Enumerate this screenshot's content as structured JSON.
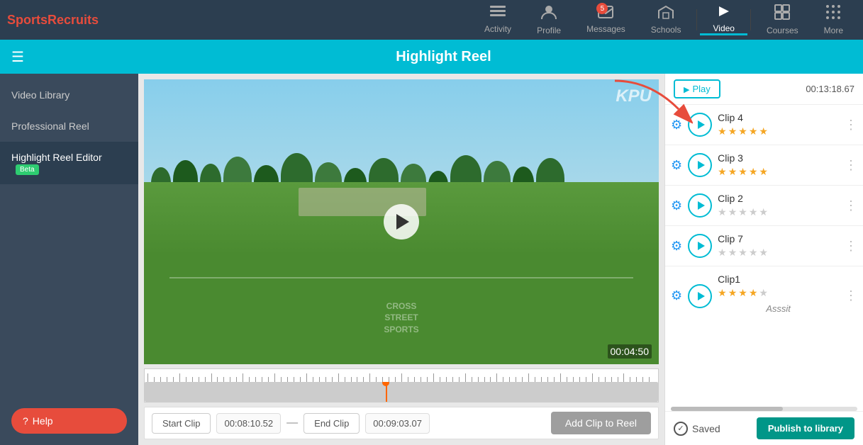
{
  "app": {
    "logo_sports": "Sports",
    "logo_recruits": "Recruits"
  },
  "nav": {
    "items": [
      {
        "id": "activity",
        "label": "Activity",
        "icon": "☰",
        "active": false,
        "badge": null
      },
      {
        "id": "profile",
        "label": "Profile",
        "icon": "👤",
        "active": false,
        "badge": null
      },
      {
        "id": "messages",
        "label": "Messages",
        "icon": "✉",
        "active": false,
        "badge": "5"
      },
      {
        "id": "schools",
        "label": "Schools",
        "icon": "🏛",
        "active": false,
        "badge": null
      },
      {
        "id": "video",
        "label": "Video",
        "icon": "▶",
        "active": true,
        "badge": null
      },
      {
        "id": "courses",
        "label": "Courses",
        "icon": "⊞",
        "active": false,
        "badge": null
      },
      {
        "id": "more",
        "label": "More",
        "icon": "⋮⋮⋮",
        "active": false,
        "badge": null
      }
    ]
  },
  "header": {
    "title": "Highlight Reel"
  },
  "sidebar": {
    "items": [
      {
        "id": "video-library",
        "label": "Video Library",
        "active": false,
        "beta": false
      },
      {
        "id": "professional-reel",
        "label": "Professional Reel",
        "active": false,
        "beta": false
      },
      {
        "id": "highlight-reel-editor",
        "label": "Highlight Reel Editor",
        "active": true,
        "beta": true
      }
    ],
    "help_label": "Help"
  },
  "video": {
    "time": "00:04:50",
    "overlay_text": "KPU",
    "watermark_line1": "CROSS",
    "watermark_line2": "STREET",
    "watermark_line3": "SPORTS"
  },
  "timeline": {
    "needle_pct": 47
  },
  "controls": {
    "start_clip_label": "Start Clip",
    "start_clip_time": "00:08:10.52",
    "end_clip_label": "End Clip",
    "end_clip_time": "00:09:03.07",
    "add_clip_label": "Add Clip to Reel"
  },
  "panel": {
    "play_label": "Play",
    "total_time": "00:13:18.67",
    "saved_label": "Saved",
    "publish_label": "Publish to library",
    "scroll_pct": 40,
    "clips": [
      {
        "id": "clip4",
        "name": "Clip 4",
        "stars_filled": 5,
        "stars_total": 5
      },
      {
        "id": "clip3",
        "name": "Clip 3",
        "stars_filled": 5,
        "stars_total": 5
      },
      {
        "id": "clip2",
        "name": "Clip 2",
        "stars_filled": 0,
        "stars_total": 5
      },
      {
        "id": "clip7",
        "name": "Clip 7",
        "stars_filled": 0,
        "stars_total": 5
      },
      {
        "id": "clip1",
        "name": "Clip1",
        "stars_filled": 4,
        "stars_total": 5,
        "tag": "Asssit"
      }
    ]
  }
}
